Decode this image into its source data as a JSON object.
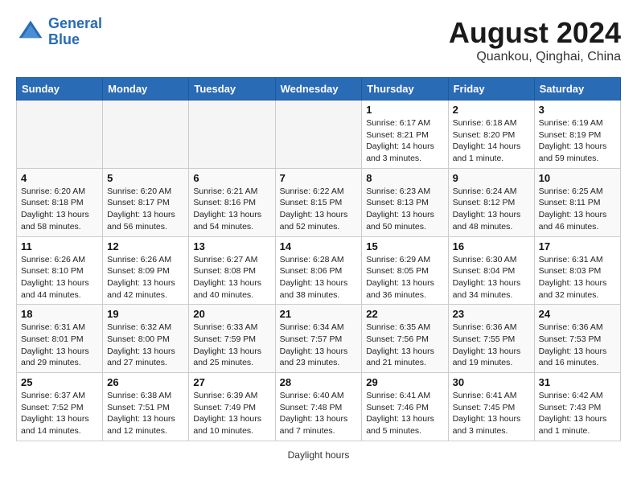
{
  "header": {
    "logo_line1": "General",
    "logo_line2": "Blue",
    "month_title": "August 2024",
    "location": "Quankou, Qinghai, China"
  },
  "calendar": {
    "days_of_week": [
      "Sunday",
      "Monday",
      "Tuesday",
      "Wednesday",
      "Thursday",
      "Friday",
      "Saturday"
    ],
    "weeks": [
      [
        {
          "day": "",
          "info": ""
        },
        {
          "day": "",
          "info": ""
        },
        {
          "day": "",
          "info": ""
        },
        {
          "day": "",
          "info": ""
        },
        {
          "day": "1",
          "info": "Sunrise: 6:17 AM\nSunset: 8:21 PM\nDaylight: 14 hours\nand 3 minutes."
        },
        {
          "day": "2",
          "info": "Sunrise: 6:18 AM\nSunset: 8:20 PM\nDaylight: 14 hours\nand 1 minute."
        },
        {
          "day": "3",
          "info": "Sunrise: 6:19 AM\nSunset: 8:19 PM\nDaylight: 13 hours\nand 59 minutes."
        }
      ],
      [
        {
          "day": "4",
          "info": "Sunrise: 6:20 AM\nSunset: 8:18 PM\nDaylight: 13 hours\nand 58 minutes."
        },
        {
          "day": "5",
          "info": "Sunrise: 6:20 AM\nSunset: 8:17 PM\nDaylight: 13 hours\nand 56 minutes."
        },
        {
          "day": "6",
          "info": "Sunrise: 6:21 AM\nSunset: 8:16 PM\nDaylight: 13 hours\nand 54 minutes."
        },
        {
          "day": "7",
          "info": "Sunrise: 6:22 AM\nSunset: 8:15 PM\nDaylight: 13 hours\nand 52 minutes."
        },
        {
          "day": "8",
          "info": "Sunrise: 6:23 AM\nSunset: 8:13 PM\nDaylight: 13 hours\nand 50 minutes."
        },
        {
          "day": "9",
          "info": "Sunrise: 6:24 AM\nSunset: 8:12 PM\nDaylight: 13 hours\nand 48 minutes."
        },
        {
          "day": "10",
          "info": "Sunrise: 6:25 AM\nSunset: 8:11 PM\nDaylight: 13 hours\nand 46 minutes."
        }
      ],
      [
        {
          "day": "11",
          "info": "Sunrise: 6:26 AM\nSunset: 8:10 PM\nDaylight: 13 hours\nand 44 minutes."
        },
        {
          "day": "12",
          "info": "Sunrise: 6:26 AM\nSunset: 8:09 PM\nDaylight: 13 hours\nand 42 minutes."
        },
        {
          "day": "13",
          "info": "Sunrise: 6:27 AM\nSunset: 8:08 PM\nDaylight: 13 hours\nand 40 minutes."
        },
        {
          "day": "14",
          "info": "Sunrise: 6:28 AM\nSunset: 8:06 PM\nDaylight: 13 hours\nand 38 minutes."
        },
        {
          "day": "15",
          "info": "Sunrise: 6:29 AM\nSunset: 8:05 PM\nDaylight: 13 hours\nand 36 minutes."
        },
        {
          "day": "16",
          "info": "Sunrise: 6:30 AM\nSunset: 8:04 PM\nDaylight: 13 hours\nand 34 minutes."
        },
        {
          "day": "17",
          "info": "Sunrise: 6:31 AM\nSunset: 8:03 PM\nDaylight: 13 hours\nand 32 minutes."
        }
      ],
      [
        {
          "day": "18",
          "info": "Sunrise: 6:31 AM\nSunset: 8:01 PM\nDaylight: 13 hours\nand 29 minutes."
        },
        {
          "day": "19",
          "info": "Sunrise: 6:32 AM\nSunset: 8:00 PM\nDaylight: 13 hours\nand 27 minutes."
        },
        {
          "day": "20",
          "info": "Sunrise: 6:33 AM\nSunset: 7:59 PM\nDaylight: 13 hours\nand 25 minutes."
        },
        {
          "day": "21",
          "info": "Sunrise: 6:34 AM\nSunset: 7:57 PM\nDaylight: 13 hours\nand 23 minutes."
        },
        {
          "day": "22",
          "info": "Sunrise: 6:35 AM\nSunset: 7:56 PM\nDaylight: 13 hours\nand 21 minutes."
        },
        {
          "day": "23",
          "info": "Sunrise: 6:36 AM\nSunset: 7:55 PM\nDaylight: 13 hours\nand 19 minutes."
        },
        {
          "day": "24",
          "info": "Sunrise: 6:36 AM\nSunset: 7:53 PM\nDaylight: 13 hours\nand 16 minutes."
        }
      ],
      [
        {
          "day": "25",
          "info": "Sunrise: 6:37 AM\nSunset: 7:52 PM\nDaylight: 13 hours\nand 14 minutes."
        },
        {
          "day": "26",
          "info": "Sunrise: 6:38 AM\nSunset: 7:51 PM\nDaylight: 13 hours\nand 12 minutes."
        },
        {
          "day": "27",
          "info": "Sunrise: 6:39 AM\nSunset: 7:49 PM\nDaylight: 13 hours\nand 10 minutes."
        },
        {
          "day": "28",
          "info": "Sunrise: 6:40 AM\nSunset: 7:48 PM\nDaylight: 13 hours\nand 7 minutes."
        },
        {
          "day": "29",
          "info": "Sunrise: 6:41 AM\nSunset: 7:46 PM\nDaylight: 13 hours\nand 5 minutes."
        },
        {
          "day": "30",
          "info": "Sunrise: 6:41 AM\nSunset: 7:45 PM\nDaylight: 13 hours\nand 3 minutes."
        },
        {
          "day": "31",
          "info": "Sunrise: 6:42 AM\nSunset: 7:43 PM\nDaylight: 13 hours\nand 1 minute."
        }
      ]
    ]
  },
  "footer": {
    "note": "Daylight hours"
  }
}
